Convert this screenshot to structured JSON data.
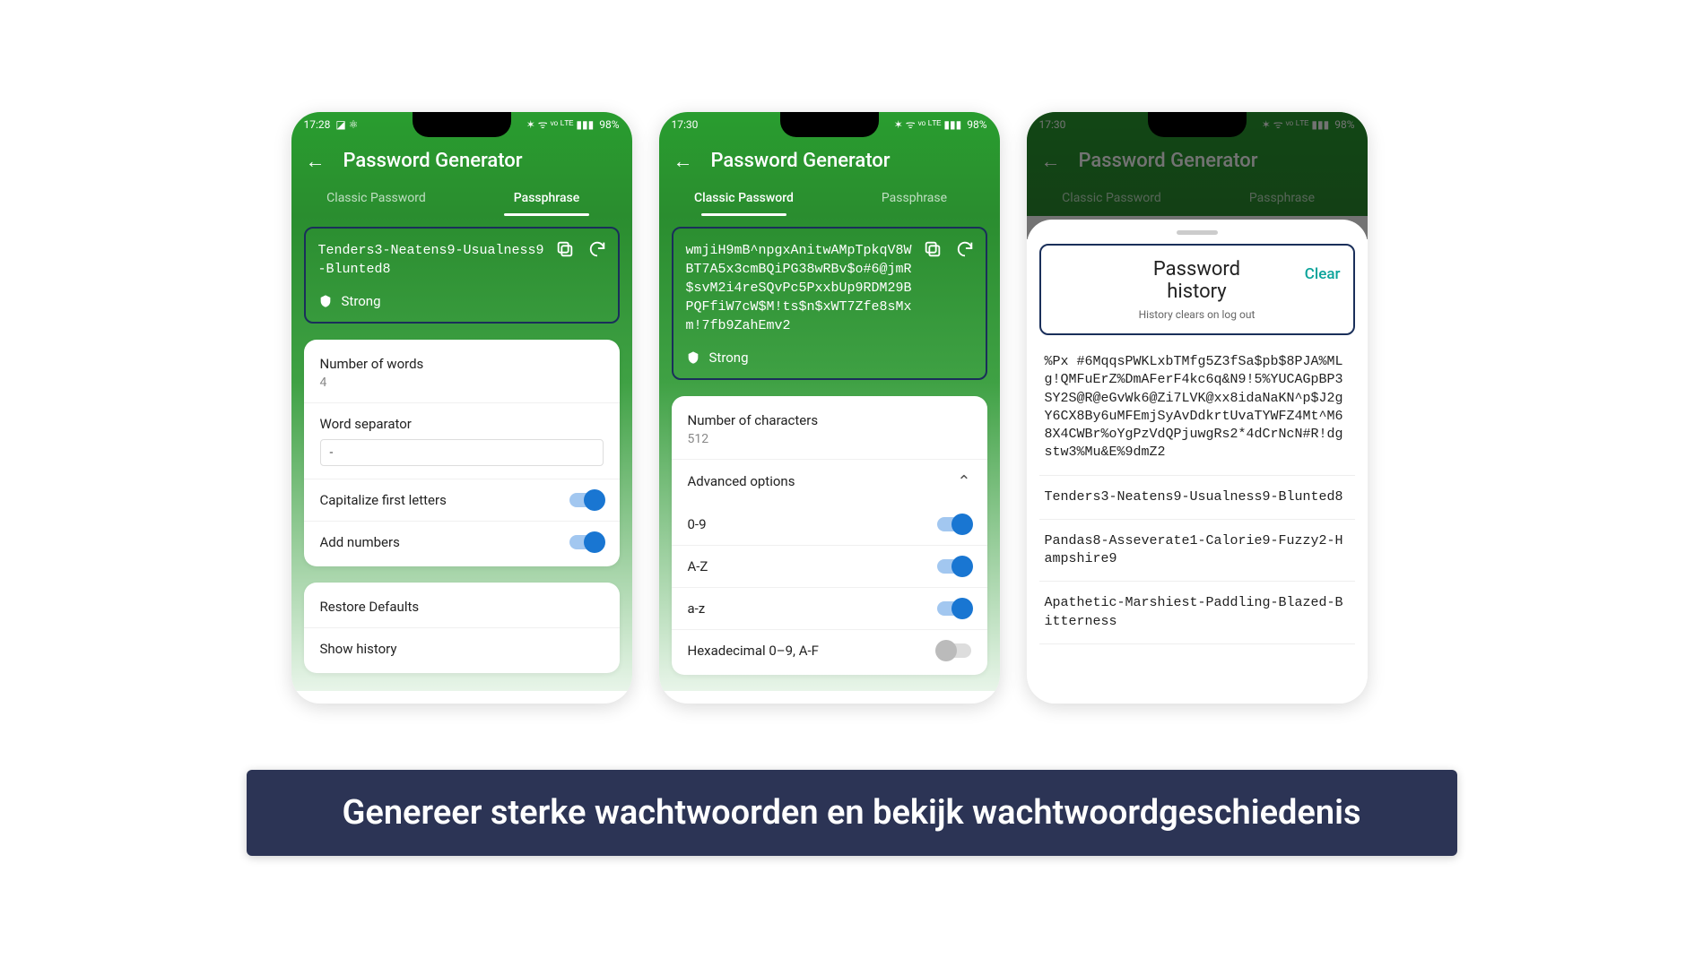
{
  "phone1": {
    "status": {
      "time": "17:28",
      "battery": "98%"
    },
    "title": "Password Generator",
    "tabs": {
      "classic": "Classic Password",
      "passphrase": "Passphrase"
    },
    "active_tab": "passphrase",
    "password": "Tenders3-Neatens9-Usualness9-Blunted8",
    "strength": "Strong",
    "num_words_label": "Number of words",
    "num_words_value": "4",
    "separator_label": "Word separator",
    "separator_value": "-",
    "capitalize_label": "Capitalize first letters",
    "add_numbers_label": "Add numbers",
    "restore_label": "Restore Defaults",
    "show_history_label": "Show history"
  },
  "phone2": {
    "status": {
      "time": "17:30",
      "battery": "98%"
    },
    "title": "Password Generator",
    "tabs": {
      "classic": "Classic Password",
      "passphrase": "Passphrase"
    },
    "active_tab": "classic",
    "password": "wmjiH9mB^npgxAnitwAMpTpkqV8WBT7A5x3cmBQiPG38wRBv$o#6@jmR$svM2i4reSQvPc5PxxbUp9RDM29BPQFfiW7cW$M!ts$n$xWT7Zfe8sMxm!7fb9ZahEmv2",
    "strength": "Strong",
    "num_chars_label": "Number of characters",
    "num_chars_value": "512",
    "advanced_label": "Advanced options",
    "opt_digits": "0-9",
    "opt_upper": "A-Z",
    "opt_lower": "a-z",
    "opt_hex": "Hexadecimal 0–9, A-F"
  },
  "phone3": {
    "status": {
      "time": "17:30",
      "battery": "98%"
    },
    "title": "Password Generator",
    "tabs": {
      "classic": "Classic Password",
      "passphrase": "Passphrase"
    },
    "history_title_1": "Password",
    "history_title_2": "history",
    "history_sub": "History clears on log out",
    "clear_label": "Clear",
    "items": [
      "%Px\n#6MqqsPWKLxbTMfg5Z3fSa$pb$8PJA%MLg!QMFuErZ%DmAFerF4kc6q&N9!5%YUCAGpBP3SY2S@R@eGvWk6@Zi7LVK@xx8idaNaKN^p$J2gY6CX8By6uMFEmjSyAvDdkrtUvaTYWFZ4Mt^M68X4CWBr%oYgPzVdQPjuwgRs2*4dCrNcN#R!dgstw3%Mu&E%9dmZ2",
      "Tenders3-Neatens9-Usualness9-Blunted8",
      "Pandas8-Asseverate1-Calorie9-Fuzzy2-Hampshire9",
      "Apathetic-Marshiest-Paddling-Blazed-Bitterness"
    ]
  },
  "banner": "Genereer sterke wachtwoorden en bekijk wachtwoordgeschiedenis"
}
